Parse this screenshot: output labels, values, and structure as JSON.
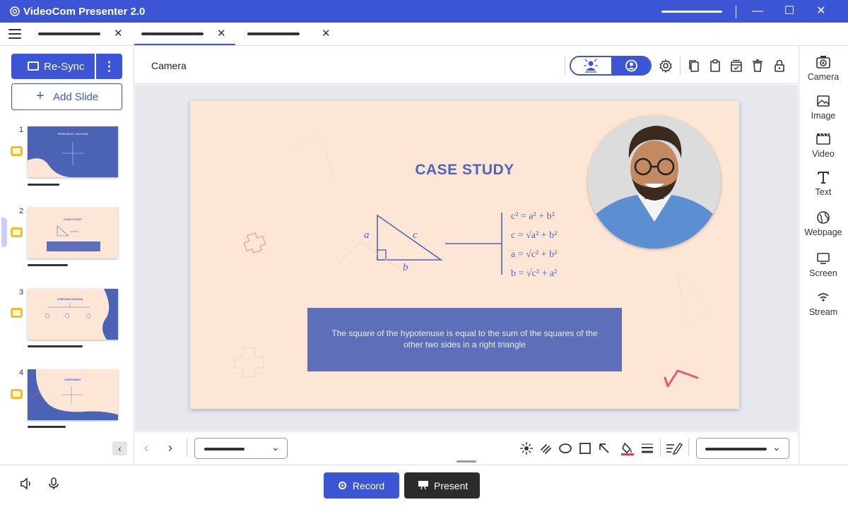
{
  "app": {
    "title": "VideoCom Presenter 2.0",
    "accent": "#3b55d4",
    "window_controls": [
      "minimize",
      "maximize",
      "close"
    ]
  },
  "tabs": [
    {
      "icon": "close-icon",
      "active": false
    },
    {
      "icon": "close-icon",
      "active": true
    },
    {
      "icon": "close-icon",
      "active": false
    }
  ],
  "sidebar": {
    "resync_label": "Re-Sync",
    "add_slide_label": "Add Slide",
    "slides": [
      {
        "number": "1",
        "selected": false,
        "title": "PROBLEM VS. SOLUTION"
      },
      {
        "number": "2",
        "selected": true,
        "title": "CASE STUDY"
      },
      {
        "number": "3",
        "selected": false,
        "title": "OVERVIEW DIAGRAM"
      },
      {
        "number": "4",
        "selected": false,
        "title": "ASSESSMENT"
      }
    ]
  },
  "editor": {
    "layer_name": "Camera",
    "toolbar_icons": [
      "background-blur-icon",
      "person-icon",
      "settings-icon",
      "copy-icon",
      "paste-icon",
      "archive-icon",
      "delete-icon",
      "lock-icon"
    ]
  },
  "slide": {
    "title": "CASE STUDY",
    "body": "The square of the hypotenuse is equal to the sum of the squares of the other two sides in a right triangle",
    "triangle_labels": {
      "a": "a",
      "b": "b",
      "c": "c"
    },
    "formulas": [
      "c² = a² + b²",
      "c = √a² + b²",
      "a = √c² + b²",
      "b = √c² + a²"
    ],
    "background": "#fde6d5",
    "box_color": "#5c6fb8",
    "title_color": "#4f66b8"
  },
  "bottom_toolbar": {
    "tools": [
      "laser-pointer-icon",
      "draw-icon",
      "ellipse-icon",
      "rectangle-icon",
      "arrow-icon",
      "fill-color-icon",
      "line-weight-icon",
      "text-edit-icon"
    ]
  },
  "right_panel": {
    "items": [
      {
        "label": "Camera",
        "icon": "camera-icon"
      },
      {
        "label": "Image",
        "icon": "image-icon"
      },
      {
        "label": "Video",
        "icon": "video-icon"
      },
      {
        "label": "Text",
        "icon": "text-icon"
      },
      {
        "label": "Webpage",
        "icon": "globe-icon"
      },
      {
        "label": "Screen",
        "icon": "screen-icon"
      },
      {
        "label": "Stream",
        "icon": "wifi-icon"
      }
    ]
  },
  "footer": {
    "record_label": "Record",
    "present_label": "Present"
  }
}
